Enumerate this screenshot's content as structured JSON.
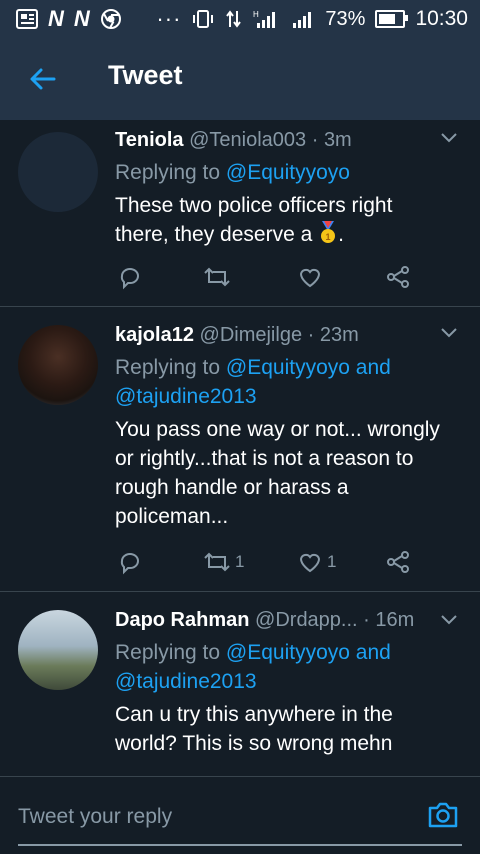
{
  "status_bar": {
    "carrier_icons": [
      "news-icon",
      "n-icon",
      "n-icon",
      "chrome-icon"
    ],
    "more_dots": "···",
    "battery_percent_label": "73%",
    "battery_level": 0.73,
    "time": "10:30"
  },
  "app_bar": {
    "title": "Tweet",
    "back_icon": "back-arrow-icon"
  },
  "tweets": [
    {
      "name": "Teniola",
      "handle": "@Teniola003",
      "separator": " · ",
      "time": "3m",
      "replying_prefix": "Replying to ",
      "mentions": "@Equityyoyo",
      "text": "These two police officers right there, they deserve a",
      "text_suffix": ".",
      "retweets": "",
      "likes": ""
    },
    {
      "name": "kajola12",
      "handle": "@Dimejilge",
      "separator": " · ",
      "time": "23m",
      "replying_prefix": "Replying to ",
      "mentions": "@Equityyoyo and @tajudine2013",
      "text": "You pass one way or not... wrongly or rightly...that is not a reason to rough handle or harass a policeman...",
      "retweets": "1",
      "likes": "1"
    },
    {
      "name": "Dapo Rahman",
      "handle": "@Drdapp...",
      "separator": " · ",
      "time": "16m",
      "replying_prefix": "Replying to ",
      "mentions": "@Equityyoyo and @tajudine2013",
      "text": "Can u try this anywhere in the world? This is so wrong mehn",
      "retweets": "",
      "likes": ""
    }
  ],
  "reply_bar": {
    "placeholder": "Tweet your reply",
    "camera_icon": "camera-icon"
  },
  "colors": {
    "background": "#141d26",
    "bar": "#243447",
    "accent": "#1da1f2",
    "muted": "#8899a6",
    "divider": "#38444d"
  }
}
